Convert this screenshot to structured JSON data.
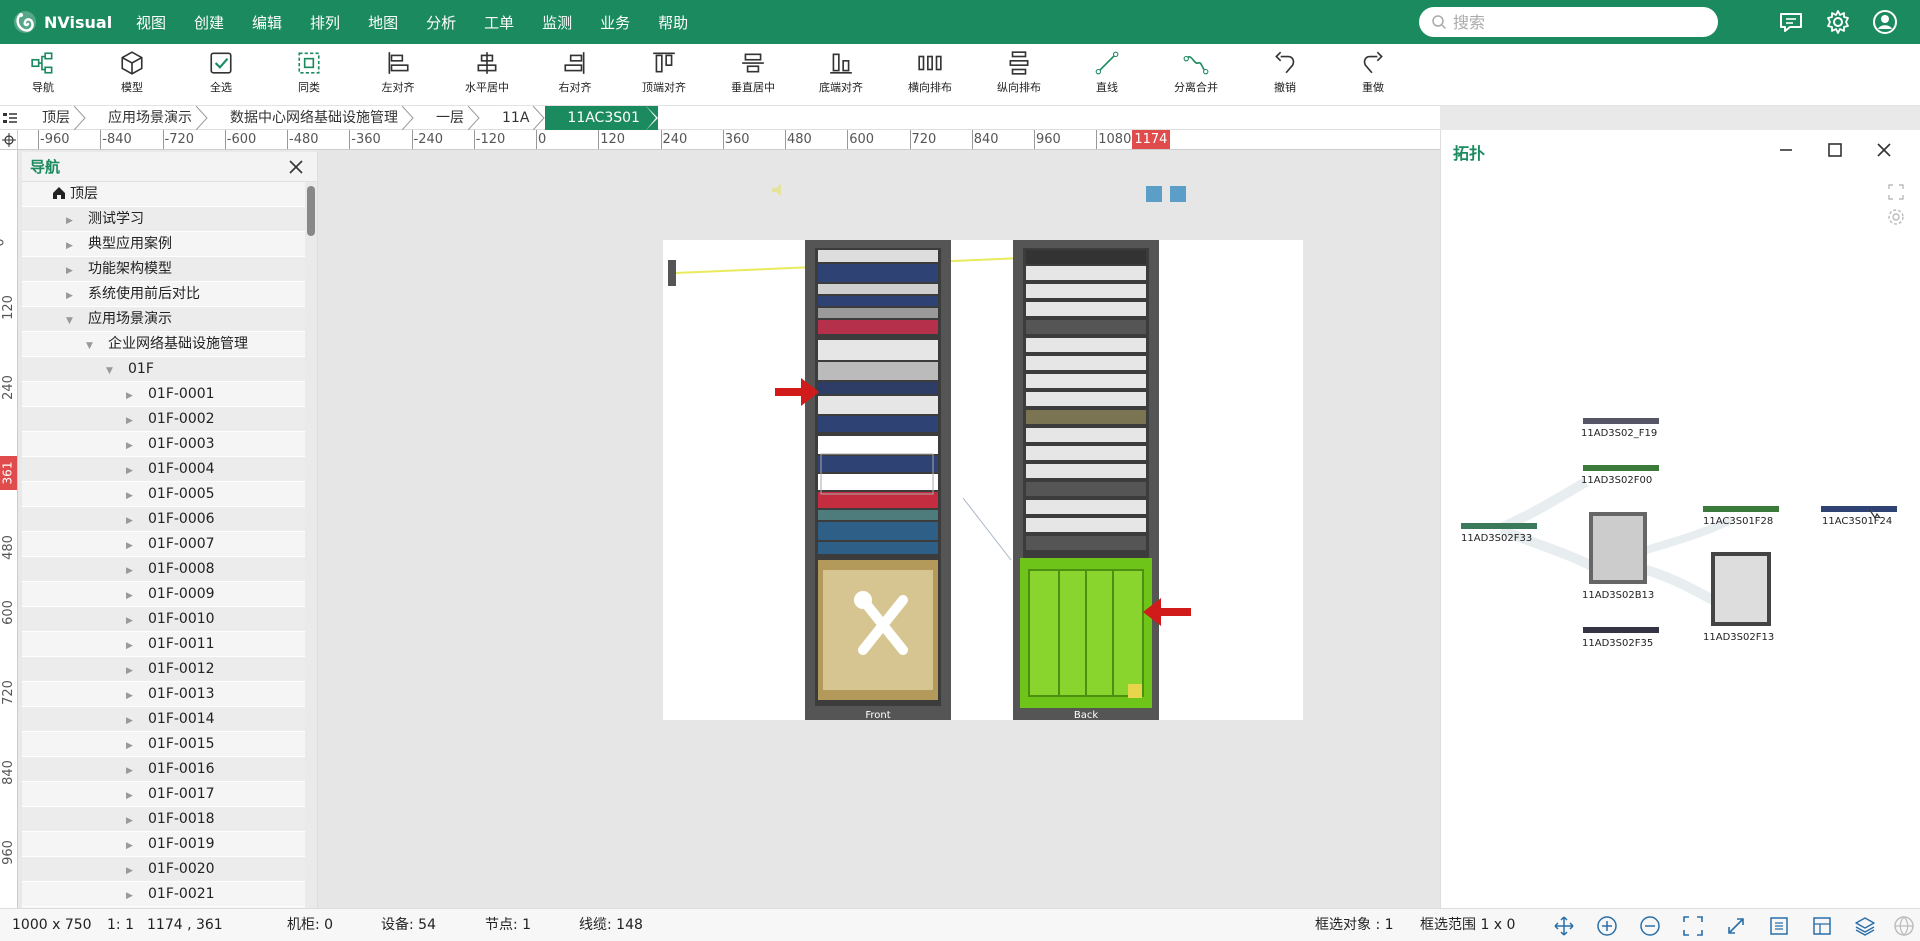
{
  "app": {
    "name": "NVisual",
    "accent": "#1c8a5f"
  },
  "menu": [
    "视图",
    "创建",
    "编辑",
    "排列",
    "地图",
    "分析",
    "工单",
    "监测",
    "业务",
    "帮助"
  ],
  "search": {
    "placeholder": "搜索"
  },
  "toolbar": [
    "导航",
    "模型",
    "全选",
    "同类",
    "左对齐",
    "水平居中",
    "右对齐",
    "顶端对齐",
    "垂直居中",
    "底端对齐",
    "横向排布",
    "纵向排布",
    "直线",
    "分离合并",
    "撤销",
    "重做"
  ],
  "breadcrumb": [
    "顶层",
    "应用场景演示",
    "数据中心网络基础设施管理",
    "一层",
    "11A",
    "11AC3S01"
  ],
  "ruler": {
    "h_ticks": [
      "-960",
      "-840",
      "-720",
      "-600",
      "-480",
      "-360",
      "-240",
      "-120",
      "0",
      "120",
      "240",
      "360",
      "480",
      "600",
      "720",
      "840",
      "960",
      "1080"
    ],
    "h_marker": "1174",
    "v_ticks": [
      "0",
      "120",
      "240",
      "480",
      "600",
      "720",
      "840",
      "960"
    ],
    "v_marker": "361"
  },
  "nav": {
    "title": "导航",
    "tree": [
      {
        "label": "顶层",
        "level": 0,
        "icon": "home"
      },
      {
        "label": "测试学习",
        "level": 1,
        "arrow": "right"
      },
      {
        "label": "典型应用案例",
        "level": 1,
        "arrow": "right"
      },
      {
        "label": "功能架构模型",
        "level": 1,
        "arrow": "right"
      },
      {
        "label": "系统使用前后对比",
        "level": 1,
        "arrow": "right"
      },
      {
        "label": "应用场景演示",
        "level": 1,
        "arrow": "down"
      },
      {
        "label": "企业网络基础设施管理",
        "level": 2,
        "arrow": "down"
      },
      {
        "label": "01F",
        "level": 3,
        "arrow": "down"
      },
      {
        "label": "01F-0001",
        "level": 4,
        "arrow": "right"
      },
      {
        "label": "01F-0002",
        "level": 4,
        "arrow": "right"
      },
      {
        "label": "01F-0003",
        "level": 4,
        "arrow": "right"
      },
      {
        "label": "01F-0004",
        "level": 4,
        "arrow": "right"
      },
      {
        "label": "01F-0005",
        "level": 4,
        "arrow": "right"
      },
      {
        "label": "01F-0006",
        "level": 4,
        "arrow": "right"
      },
      {
        "label": "01F-0007",
        "level": 4,
        "arrow": "right"
      },
      {
        "label": "01F-0008",
        "level": 4,
        "arrow": "right"
      },
      {
        "label": "01F-0009",
        "level": 4,
        "arrow": "right"
      },
      {
        "label": "01F-0010",
        "level": 4,
        "arrow": "right"
      },
      {
        "label": "01F-0011",
        "level": 4,
        "arrow": "right"
      },
      {
        "label": "01F-0012",
        "level": 4,
        "arrow": "right"
      },
      {
        "label": "01F-0013",
        "level": 4,
        "arrow": "right"
      },
      {
        "label": "01F-0014",
        "level": 4,
        "arrow": "right"
      },
      {
        "label": "01F-0015",
        "level": 4,
        "arrow": "right"
      },
      {
        "label": "01F-0016",
        "level": 4,
        "arrow": "right"
      },
      {
        "label": "01F-0017",
        "level": 4,
        "arrow": "right"
      },
      {
        "label": "01F-0018",
        "level": 4,
        "arrow": "right"
      },
      {
        "label": "01F-0019",
        "level": 4,
        "arrow": "right"
      },
      {
        "label": "01F-0020",
        "level": 4,
        "arrow": "right"
      },
      {
        "label": "01F-0021",
        "level": 4,
        "arrow": "right"
      }
    ]
  },
  "racks": {
    "front_label": "Front",
    "back_label": "Back"
  },
  "topology": {
    "title": "拓扑",
    "nodes": [
      "11AD3S02_F19",
      "11AD3S02F00",
      "11AD3S02F33",
      "11AD3S02B13",
      "11AC3S01F28",
      "11AC3S01F24",
      "11AD3S02F35",
      "11AD3S02F13"
    ]
  },
  "status": {
    "canvas_size": "1000 x 750",
    "zoom": "1: 1",
    "coords": "1174 , 361",
    "cabinets": "机柜: 0",
    "devices": "设备: 54",
    "nodes": "节点: 1",
    "cables": "线缆: 148",
    "selected": "框选对象 : 1",
    "range": "框选范围 1 x 0"
  }
}
